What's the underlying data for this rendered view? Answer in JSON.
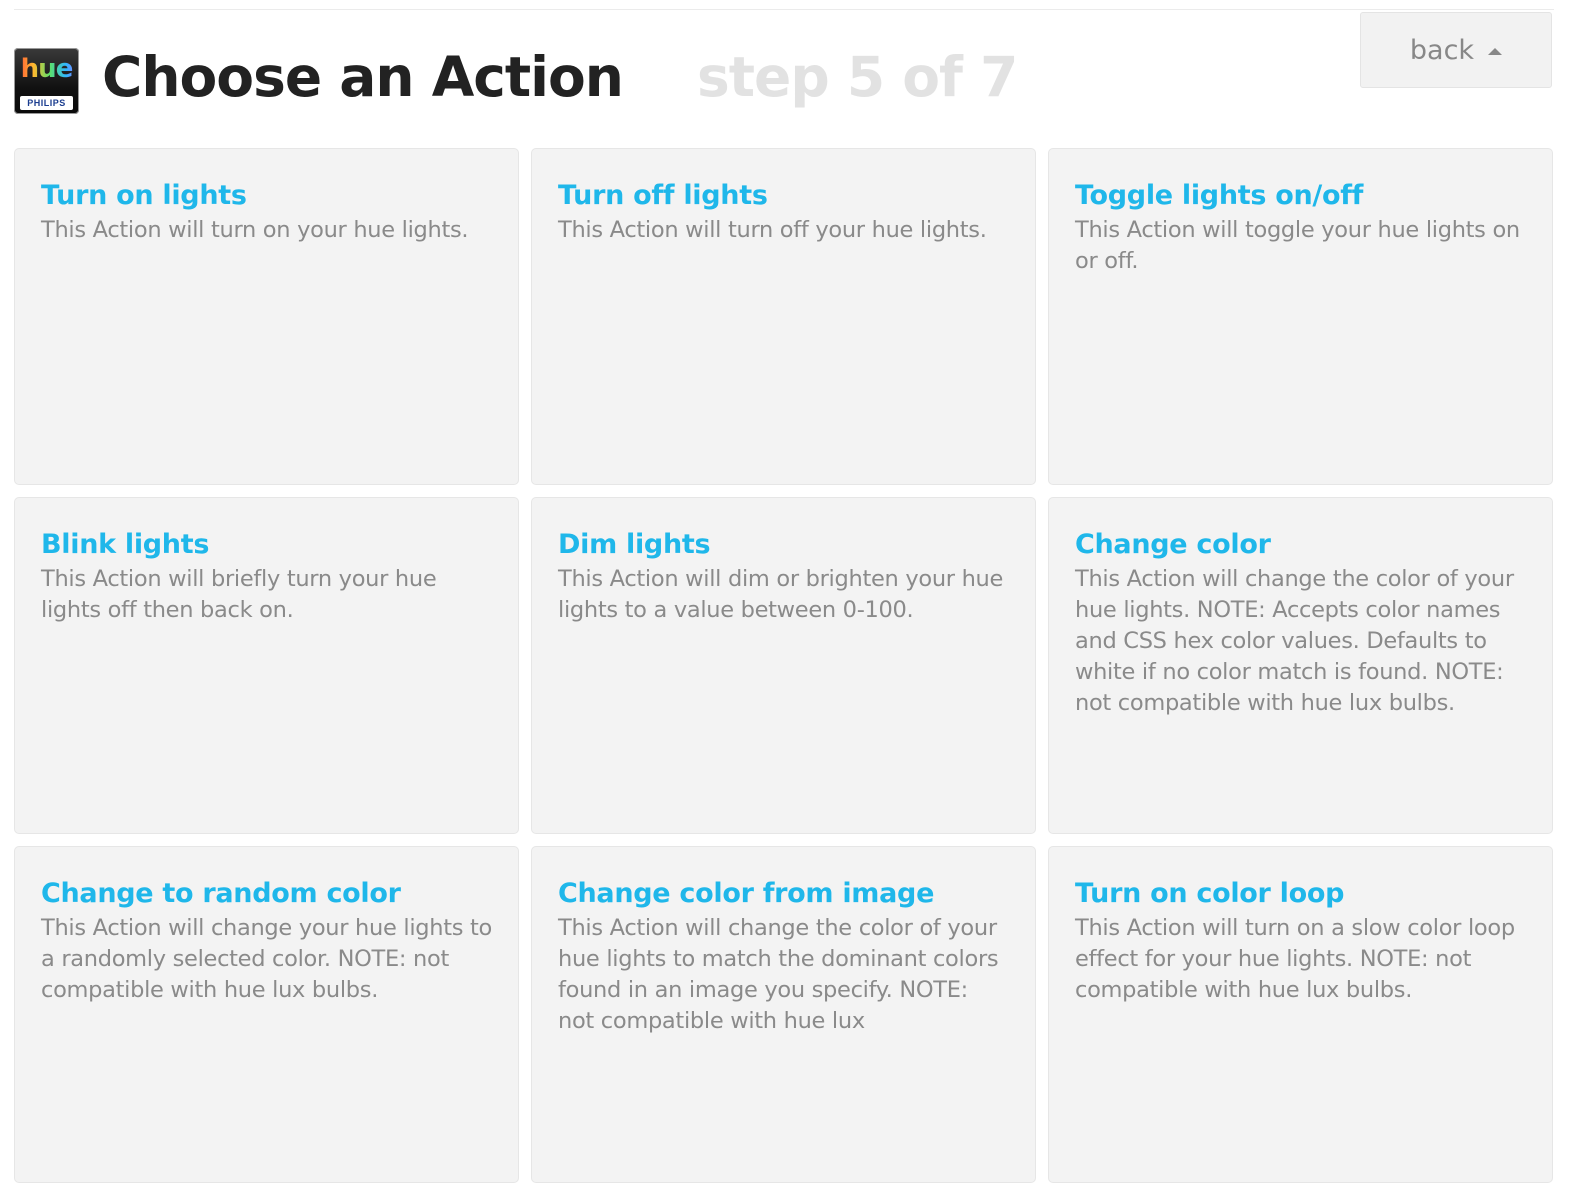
{
  "header": {
    "title": "Choose an Action",
    "step": "step 5 of 7",
    "back_label": "back",
    "logo": {
      "word": "hue",
      "brand": "PHILIPS"
    }
  },
  "colors": {
    "card_title": "#1fb7ea",
    "card_text": "#8a8a8a",
    "card_bg": "#f3f3f3",
    "step_text": "#e2e2e2"
  },
  "actions": [
    {
      "title": "Turn on lights",
      "description": "This Action will turn on your hue lights."
    },
    {
      "title": "Turn off lights",
      "description": "This Action will turn off your hue lights."
    },
    {
      "title": "Toggle lights on/off",
      "description": "This Action will toggle your hue lights on or off."
    },
    {
      "title": "Blink lights",
      "description": "This Action will briefly turn your hue lights off then back on."
    },
    {
      "title": "Dim lights",
      "description": "This Action will dim or brighten your hue lights to a value between 0-100."
    },
    {
      "title": "Change color",
      "description": "This Action will change the color of your hue lights. NOTE: Accepts color names and CSS hex color values. Defaults to white if no color match is found. NOTE: not compatible with hue lux bulbs."
    },
    {
      "title": "Change to random color",
      "description": "This Action will change your hue lights to a randomly selected color. NOTE: not compatible with hue lux bulbs."
    },
    {
      "title": "Change color from image",
      "description": "This Action will change the color of your hue lights to match the dominant colors found in an image you specify. NOTE: not compatible with hue lux"
    },
    {
      "title": "Turn on color loop",
      "description": "This Action will turn on a slow color loop effect for your hue lights. NOTE: not compatible with hue lux bulbs."
    }
  ]
}
